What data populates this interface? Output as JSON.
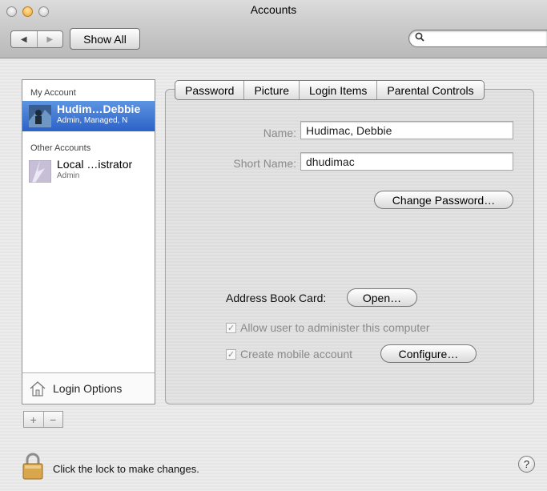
{
  "window": {
    "title": "Accounts",
    "show_all_label": "Show All",
    "search": {
      "placeholder": ""
    }
  },
  "sidebar": {
    "my_account_label": "My Account",
    "other_accounts_label": "Other Accounts",
    "accounts": [
      {
        "name": "Hudim…Debbie",
        "subtitle": "Admin, Managed, N",
        "selected": true
      },
      {
        "name": "Local …istrator",
        "subtitle": "Admin",
        "selected": false
      }
    ],
    "login_options_label": "Login Options",
    "add_symbol": "+",
    "remove_symbol": "−"
  },
  "tabs": [
    {
      "label": "Password",
      "active": false
    },
    {
      "label": "Picture",
      "active": false
    },
    {
      "label": "Login Items",
      "active": false
    },
    {
      "label": "Parental Controls",
      "active": false
    }
  ],
  "password_pane": {
    "name_label": "Name:",
    "name_value": "Hudimac, Debbie",
    "short_name_label": "Short Name:",
    "short_name_value": "dhudimac",
    "change_password_label": "Change Password…",
    "address_book_label": "Address Book Card:",
    "open_label": "Open…",
    "allow_admin_label": "Allow user to administer this computer",
    "allow_admin_checked": true,
    "mobile_account_label": "Create mobile account",
    "mobile_account_checked": true,
    "configure_label": "Configure…"
  },
  "footer": {
    "lock_text": "Click the lock to make changes.",
    "help_label": "?"
  },
  "colors": {
    "selection": "#3d74d6",
    "window_bg": "#e8e8e8"
  }
}
